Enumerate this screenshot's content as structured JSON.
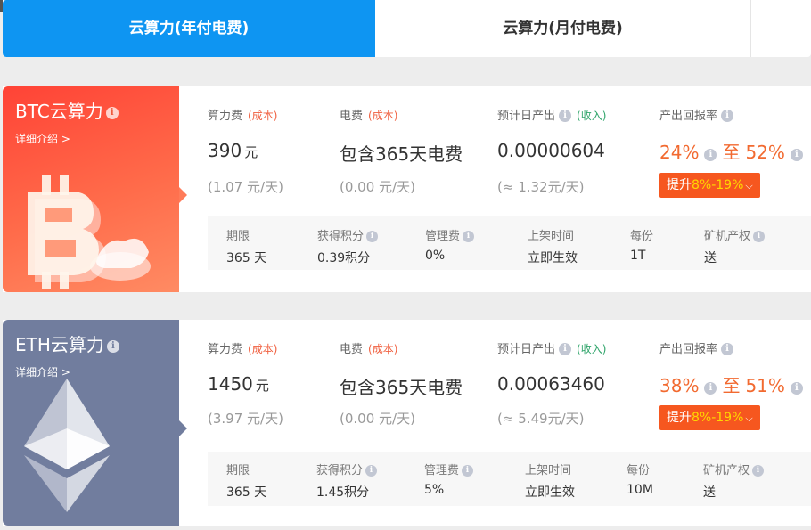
{
  "tabs": [
    {
      "label": "云算力(年付电费)",
      "active": true
    },
    {
      "label": "云算力(月付电费)",
      "active": false
    }
  ],
  "colors": {
    "accent": "#0e95f2",
    "orange": "#f26a30",
    "boost_bg": "#f6571f",
    "boost_highlight": "#ffd800"
  },
  "cards": [
    {
      "title": "BTC云算力",
      "detail_link": "详细介绍 >",
      "illustration": "bitcoin-coin-icon",
      "hash_fee": {
        "label": "算力费",
        "tag": "(成本)",
        "value": "390",
        "unit": "元",
        "sub": "(1.07 元/天)"
      },
      "power_fee": {
        "label": "电费",
        "tag": "(成本)",
        "value": "包含365天电费",
        "sub": "(0.00 元/天)"
      },
      "daily_output": {
        "label": "预计日产出",
        "tag": "(收入)",
        "value": "0.00000604",
        "sub": "(≈ 1.32元/天)"
      },
      "return_rate": {
        "label": "产出回报率",
        "low": "24%",
        "to": "至",
        "high": "52%",
        "boost_prefix": "提升",
        "boost_range": "8%-19%"
      },
      "details": [
        {
          "label": "期限",
          "value": "365 天",
          "info": false
        },
        {
          "label": "获得积分",
          "value": "0.39积分",
          "info": true
        },
        {
          "label": "管理费",
          "value": "0%",
          "info": true
        },
        {
          "label": "上架时间",
          "value": "立即生效",
          "info": false
        },
        {
          "label": "每份",
          "value": "1T",
          "info": false
        },
        {
          "label": "矿机产权",
          "value": "送",
          "info": true
        }
      ]
    },
    {
      "title": "ETH云算力",
      "detail_link": "详细介绍 >",
      "illustration": "ethereum-icon",
      "hash_fee": {
        "label": "算力费",
        "tag": "(成本)",
        "value": "1450",
        "unit": "元",
        "sub": "(3.97 元/天)"
      },
      "power_fee": {
        "label": "电费",
        "tag": "(成本)",
        "value": "包含365天电费",
        "sub": "(0.00 元/天)"
      },
      "daily_output": {
        "label": "预计日产出",
        "tag": "(收入)",
        "value": "0.00063460",
        "sub": "(≈ 5.49元/天)"
      },
      "return_rate": {
        "label": "产出回报率",
        "low": "38%",
        "to": "至",
        "high": "51%",
        "boost_prefix": "提升",
        "boost_range": "8%-19%"
      },
      "details": [
        {
          "label": "期限",
          "value": "365 天",
          "info": false
        },
        {
          "label": "获得积分",
          "value": "1.45积分",
          "info": true
        },
        {
          "label": "管理费",
          "value": "5%",
          "info": true
        },
        {
          "label": "上架时间",
          "value": "立即生效",
          "info": false
        },
        {
          "label": "每份",
          "value": "10M",
          "info": false
        },
        {
          "label": "矿机产权",
          "value": "送",
          "info": true
        }
      ]
    }
  ]
}
